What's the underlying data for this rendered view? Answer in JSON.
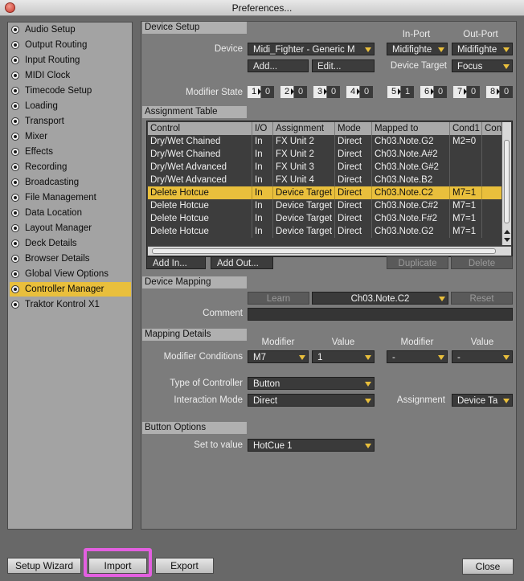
{
  "window": {
    "title": "Preferences..."
  },
  "sidebar": {
    "items": [
      {
        "label": "Audio Setup"
      },
      {
        "label": "Output Routing"
      },
      {
        "label": "Input Routing"
      },
      {
        "label": "MIDI Clock"
      },
      {
        "label": "Timecode Setup"
      },
      {
        "label": "Loading"
      },
      {
        "label": "Transport"
      },
      {
        "label": "Mixer"
      },
      {
        "label": "Effects"
      },
      {
        "label": "Recording"
      },
      {
        "label": "Broadcasting"
      },
      {
        "label": "File Management"
      },
      {
        "label": "Data Location"
      },
      {
        "label": "Layout Manager"
      },
      {
        "label": "Deck Details"
      },
      {
        "label": "Browser Details"
      },
      {
        "label": "Global View Options"
      },
      {
        "label": "Controller Manager"
      },
      {
        "label": "Traktor Kontrol X1"
      }
    ],
    "selected": "Controller Manager"
  },
  "device_setup": {
    "header": "Device Setup",
    "device_label": "Device",
    "device_value": "Midi_Fighter - Generic M",
    "in_port_label": "In-Port",
    "out_port_label": "Out-Port",
    "in_port_value": "Midifighte",
    "out_port_value": "Midifighte",
    "add_button": "Add...",
    "edit_button": "Edit...",
    "device_target_label": "Device Target",
    "device_target_value": "Focus",
    "modifier_state_label": "Modifier State",
    "modifiers": [
      {
        "n": "1",
        "v": "0"
      },
      {
        "n": "2",
        "v": "0"
      },
      {
        "n": "3",
        "v": "0"
      },
      {
        "n": "4",
        "v": "0"
      },
      {
        "n": "5",
        "v": "1"
      },
      {
        "n": "6",
        "v": "0"
      },
      {
        "n": "7",
        "v": "0"
      },
      {
        "n": "8",
        "v": "0"
      }
    ]
  },
  "assignment_table": {
    "header": "Assignment Table",
    "columns": [
      "Control",
      "I/O",
      "Assignment",
      "Mode",
      "Mapped to",
      "Cond1",
      "Con"
    ],
    "rows": [
      [
        "Dry/Wet Chained",
        "In",
        "FX Unit 2",
        "Direct",
        "Ch03.Note.G2",
        "M2=0",
        ""
      ],
      [
        "Dry/Wet Chained",
        "In",
        "FX Unit 2",
        "Direct",
        "Ch03.Note.A#2",
        "",
        ""
      ],
      [
        "Dry/Wet Advanced",
        "In",
        "FX Unit 3",
        "Direct",
        "Ch03.Note.G#2",
        "",
        ""
      ],
      [
        "Dry/Wet Advanced",
        "In",
        "FX Unit 4",
        "Direct",
        "Ch03.Note.B2",
        "",
        ""
      ],
      [
        "Delete Hotcue",
        "In",
        "Device Target",
        "Direct",
        "Ch03.Note.C2",
        "M7=1",
        ""
      ],
      [
        "Delete Hotcue",
        "In",
        "Device Target",
        "Direct",
        "Ch03.Note.C#2",
        "M7=1",
        ""
      ],
      [
        "Delete Hotcue",
        "In",
        "Device Target",
        "Direct",
        "Ch03.Note.F#2",
        "M7=1",
        ""
      ],
      [
        "Delete Hotcue",
        "In",
        "Device Target",
        "Direct",
        "Ch03.Note.G2",
        "M7=1",
        ""
      ]
    ],
    "selected_row": 4,
    "add_in_button": "Add In...",
    "add_out_button": "Add Out...",
    "duplicate_button": "Duplicate",
    "delete_button": "Delete"
  },
  "device_mapping": {
    "header": "Device Mapping",
    "learn_button": "Learn",
    "mapping_value": "Ch03.Note.C2",
    "reset_button": "Reset",
    "comment_label": "Comment",
    "comment_value": ""
  },
  "mapping_details": {
    "header": "Mapping Details",
    "modifier_label_1": "Modifier",
    "value_label_1": "Value",
    "modifier_label_2": "Modifier",
    "value_label_2": "Value",
    "modifier_conditions_label": "Modifier Conditions",
    "mod1_value": "M7",
    "val1_value": "1",
    "mod2_value": "-",
    "val2_value": "-",
    "type_of_controller_label": "Type of Controller",
    "type_of_controller_value": "Button",
    "interaction_mode_label": "Interaction Mode",
    "interaction_mode_value": "Direct",
    "assignment_label": "Assignment",
    "assignment_value": "Device Ta"
  },
  "button_options": {
    "header": "Button Options",
    "set_to_value_label": "Set to value",
    "set_to_value_value": "HotCue 1"
  },
  "footer": {
    "setup_wizard": "Setup Wizard",
    "import": "Import",
    "export": "Export",
    "close": "Close"
  },
  "colors": {
    "accent": "#e9bf3c",
    "highlight": "#e35fe0"
  }
}
